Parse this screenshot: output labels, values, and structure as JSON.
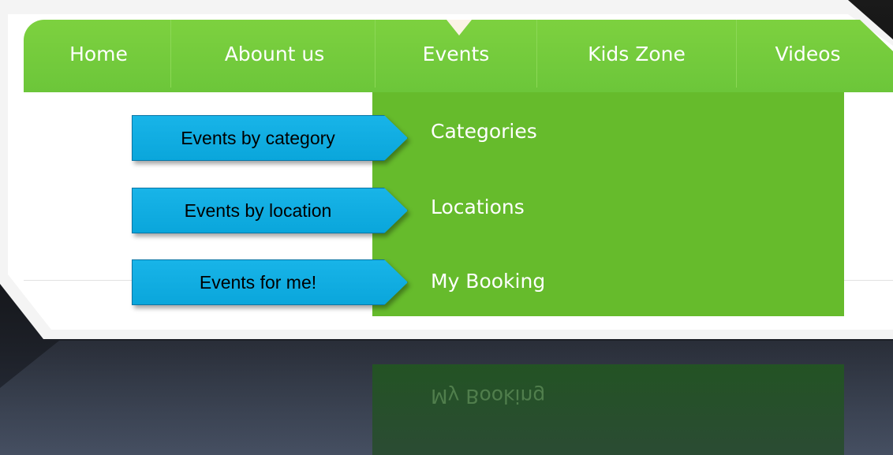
{
  "nav": {
    "items": [
      "Home",
      "Abount us",
      "Events",
      "Kids Zone",
      "Videos"
    ],
    "active": "Events"
  },
  "dropdown": {
    "items": [
      "Categories",
      "Locations",
      "My Booking"
    ],
    "reflection_text": "My Booking"
  },
  "callouts": [
    "Events by category",
    "Events by location",
    "Events for me!"
  ],
  "colors": {
    "nav_green": "#6cc63a",
    "dropdown_green": "#66bb2c",
    "callout_blue": "#12aee4"
  }
}
